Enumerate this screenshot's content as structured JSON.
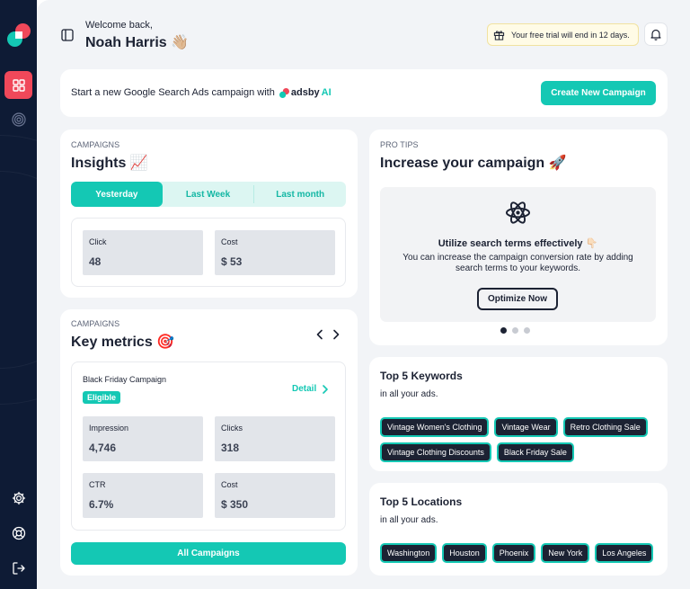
{
  "sidebar": {
    "logo": "adsby-logo",
    "items": [
      {
        "icon": "grid-icon",
        "active": true
      },
      {
        "icon": "target-icon",
        "active": false
      }
    ],
    "bottom": [
      {
        "icon": "gear-icon"
      },
      {
        "icon": "lifebuoy-icon"
      },
      {
        "icon": "logout-icon"
      }
    ]
  },
  "header": {
    "welcome": "Welcome back,",
    "user_name": "Noah Harris 👋🏼",
    "trial_text": "Your free trial will end in 12 days."
  },
  "banner": {
    "text": "Start a new Google Search Ads campaign with",
    "brand_main": "adsby",
    "brand_ai": "AI",
    "button": "Create New Campaign"
  },
  "insights": {
    "eyebrow": "CAMPAIGNS",
    "title": "Insights 📈",
    "tabs": [
      "Yesterday",
      "Last Week",
      "Last month"
    ],
    "stats": [
      {
        "label": "Click",
        "value": "48"
      },
      {
        "label": "Cost",
        "value": "$ 53"
      }
    ]
  },
  "key_metrics": {
    "eyebrow": "CAMPAIGNS",
    "title": "Key metrics 🎯",
    "campaign_name": "Black Friday Campaign",
    "badge": "Eligible",
    "detail": "Detail",
    "stats": [
      {
        "label": "Impression",
        "value": "4,746"
      },
      {
        "label": "Clicks",
        "value": "318"
      },
      {
        "label": "CTR",
        "value": "6.7%"
      },
      {
        "label": "Cost",
        "value": "$ 350"
      }
    ],
    "button": "All Campaigns"
  },
  "pro_tips": {
    "eyebrow": "PRO TIPS",
    "title": "Increase your campaign 🚀",
    "tip_title": "Utilize search terms effectively 👇🏻",
    "tip_desc": "You can increase the campaign conversion rate by adding search terms to your keywords.",
    "button": "Optimize Now",
    "dots": 3,
    "active_dot": 1
  },
  "keywords": {
    "title": "Top 5 Keywords",
    "subtitle": "in all your ads.",
    "items": [
      "Vintage Women's Clothing",
      "Vintage Wear",
      "Retro Clothing Sale",
      "Vintage Clothing Discounts",
      "Black Friday Sale"
    ]
  },
  "locations": {
    "title": "Top 5 Locations",
    "subtitle": "in all your ads.",
    "items": [
      "Washington",
      "Houston",
      "Phoenix",
      "New York",
      "Los Angeles"
    ]
  },
  "colors": {
    "accent": "#14c8b4",
    "sidebar": "#0e1b35",
    "active_nav": "#f0485a",
    "chip_bg": "#1c2233"
  }
}
